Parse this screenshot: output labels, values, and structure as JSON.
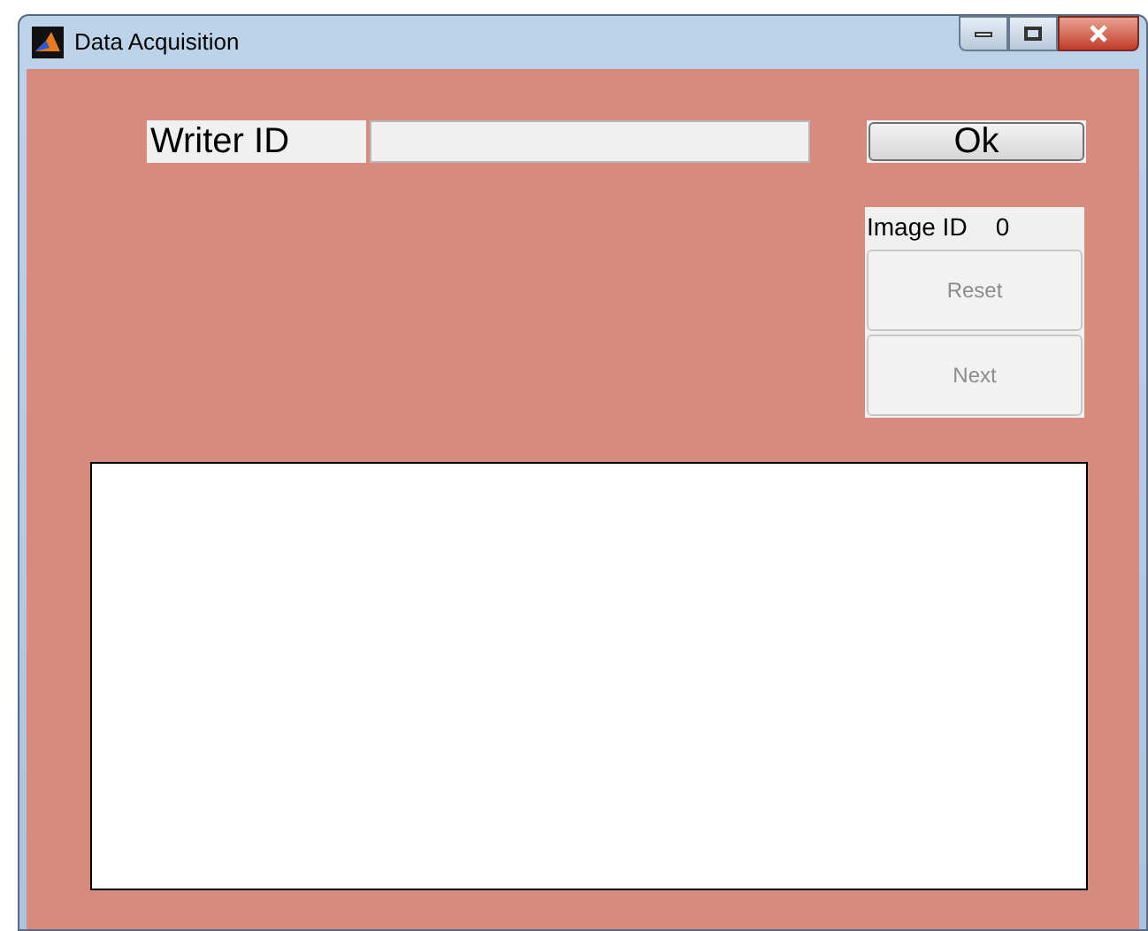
{
  "window": {
    "title": "Data Acquisition"
  },
  "writer_id": {
    "label": "Writer ID"
  },
  "ok_button": {
    "label": "Ok"
  },
  "image_id": {
    "label": "Image ID",
    "value": "0"
  },
  "buttons": [
    {
      "label": "Reset",
      "disabled": true
    },
    {
      "label": "Next",
      "disabled": true
    }
  ]
}
